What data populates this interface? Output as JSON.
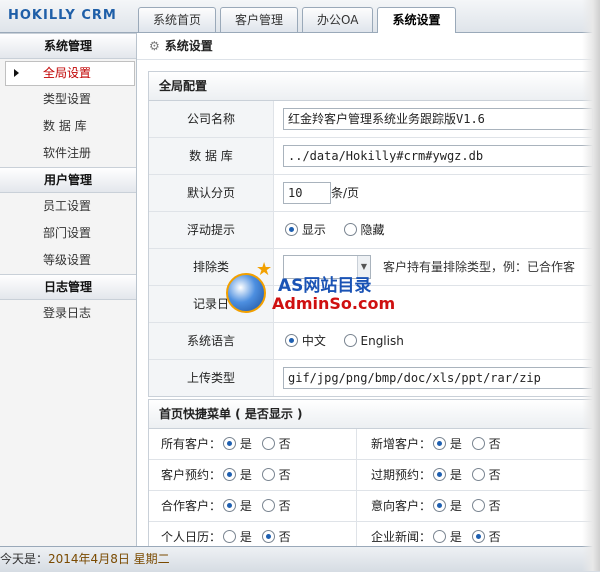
{
  "app": {
    "logo": "HOKILLY CRM"
  },
  "tabs": [
    {
      "label": "系统首页"
    },
    {
      "label": "客户管理"
    },
    {
      "label": "办公OA"
    },
    {
      "label": "系统设置"
    }
  ],
  "sidebar": {
    "groups": [
      {
        "title": "系统管理",
        "items": [
          "全局设置",
          "类型设置",
          "数 据 库",
          "软件注册"
        ]
      },
      {
        "title": "用户管理",
        "items": [
          "员工设置",
          "部门设置",
          "等级设置"
        ]
      },
      {
        "title": "日志管理",
        "items": [
          "登录日志"
        ]
      }
    ]
  },
  "breadcrumb": "系统设置",
  "global": {
    "title": "全局配置",
    "company_label": "公司名称",
    "company_value": "红金羚客户管理系统业务跟踪版V1.6",
    "db_label": "数 据 库",
    "db_value": "../data/Hokilly#crm#ywgz.db",
    "page_label": "默认分页",
    "page_value": "10",
    "page_unit": "条/页",
    "float_label": "浮动提示",
    "float_show": "显示",
    "float_hide": "隐藏",
    "exclude_label": "排除类",
    "exclude_hint": "客户持有量排除类型，例：已合作客",
    "log_label": "记录日",
    "lang_label": "系统语言",
    "lang_cn": "中文",
    "lang_en": "English",
    "upload_label": "上传类型",
    "upload_value": "gif/jpg/png/bmp/doc/xls/ppt/rar/zip"
  },
  "quick": {
    "title": "首页快捷菜单 ( 是否显示 )",
    "yes": "是",
    "no": "否",
    "rows": [
      {
        "left": "所有客户：",
        "right": "新增客户："
      },
      {
        "left": "客户预约：",
        "right": "过期预约："
      },
      {
        "left": "合作客户：",
        "right": "意向客户："
      },
      {
        "left": "个人日历：",
        "right": "企业新闻："
      }
    ]
  },
  "watermark": {
    "line1": "AS网站目录",
    "line2": "AdminSo.com"
  },
  "status": {
    "prefix": "今天是：",
    "date": "2014年4月8日 星期二"
  }
}
